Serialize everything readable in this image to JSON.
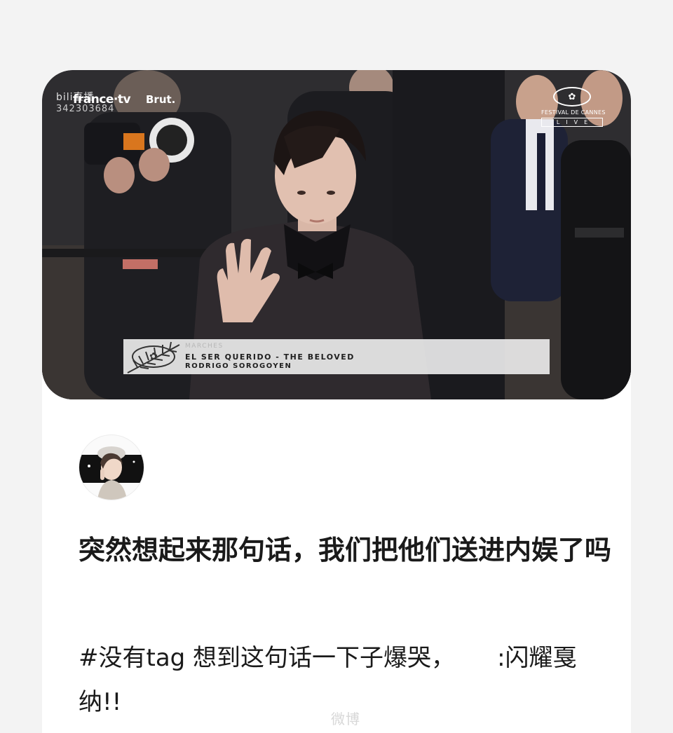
{
  "video": {
    "bilibili_label": "bili直播",
    "stream_id": "342303684",
    "broadcaster": "france·tv",
    "partner": "Brut.",
    "festival_name": "FESTIVAL DE CANNES",
    "live_label": "LIVE",
    "banner": {
      "label": "MARCHES",
      "film_title": "EL SER QUERIDO - THE BELOVED",
      "director": "RODRIGO SOROGOYEN"
    }
  },
  "post": {
    "title": "突然想起来那句话，我们把他们送进内娱了吗",
    "hashtag": "#没有tag",
    "body_text": " 想到这句话一下子爆哭，",
    "body_suffix": ":闪耀戛纳!!"
  },
  "watermark": "微博"
}
